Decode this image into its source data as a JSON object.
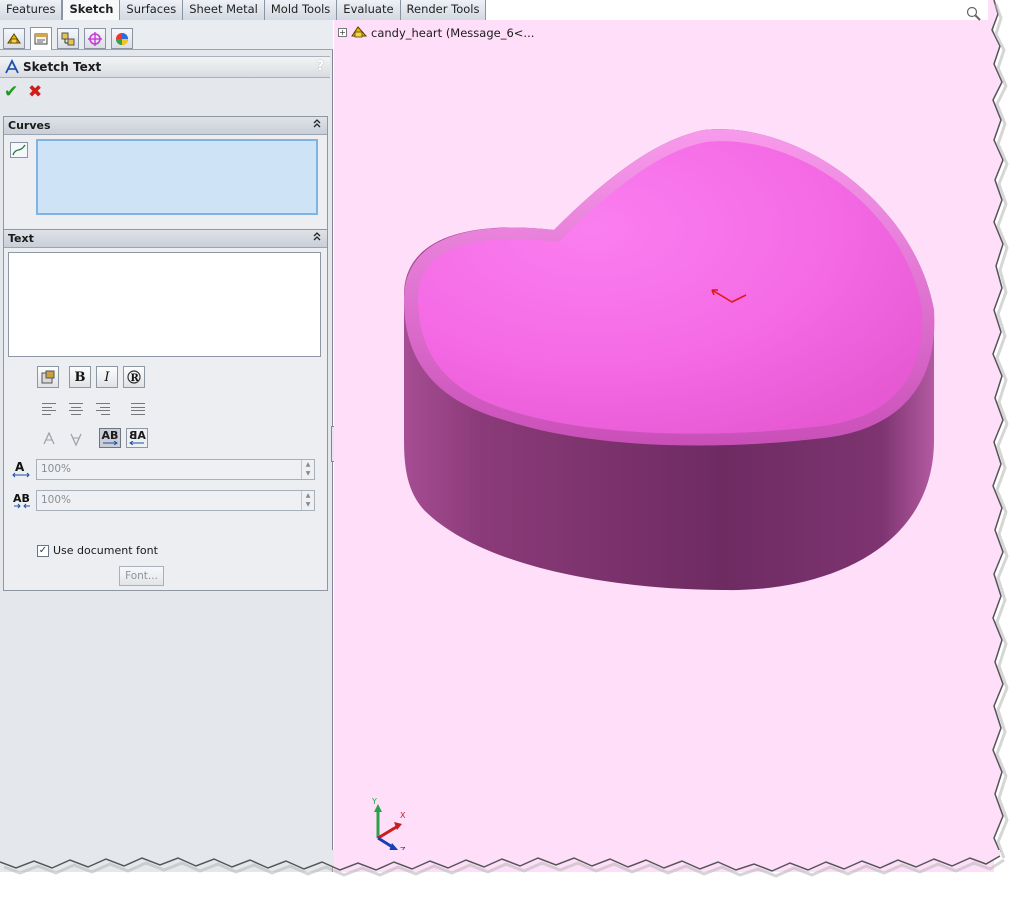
{
  "command_tabs": [
    "Features",
    "Sketch",
    "Surfaces",
    "Sheet Metal",
    "Mold Tools",
    "Evaluate",
    "Render Tools"
  ],
  "active_tab": "Sketch",
  "manager_tabs": [
    "feature-manager-icon",
    "property-manager-icon",
    "configuration-manager-icon",
    "dimxpert-icon",
    "display-manager-icon"
  ],
  "property_manager": {
    "title": "Sketch Text",
    "help": "?",
    "ok_symbol": "✔",
    "cancel_symbol": "✖"
  },
  "curves_group": {
    "title": "Curves",
    "collapse_symbol": "⌃"
  },
  "text_group": {
    "title": "Text",
    "collapse_symbol": "⌃",
    "text_value": "",
    "bold_label": "B",
    "italic_label": "I",
    "rotate_label": "R",
    "mirror_horizontal_label": "AB",
    "mirror_vertical_label": "AB",
    "width_factor": "100%",
    "spacing": "100%",
    "use_document_font_label": "Use document font",
    "use_document_font_checked": true,
    "font_button_label": "Font..."
  },
  "graphics": {
    "tree_item": "candy_heart  (Message_6<...",
    "background_color": "#fedef9",
    "model_color": "#f56ee6",
    "triad": {
      "x": "X",
      "y": "Y",
      "z": "Z"
    }
  }
}
